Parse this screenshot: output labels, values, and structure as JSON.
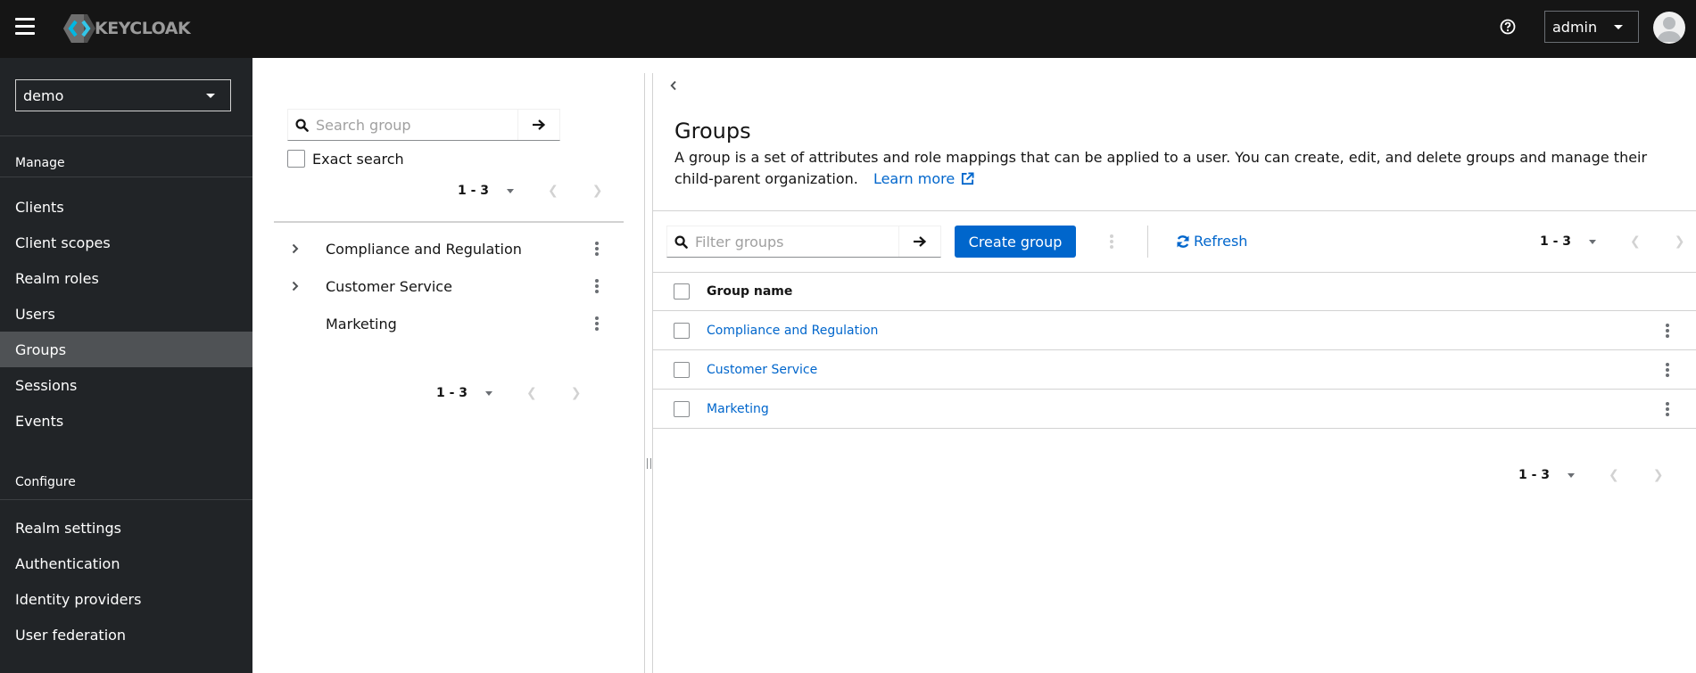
{
  "masthead": {
    "brand": "KEYCLOAK",
    "user": "admin",
    "icons": {
      "menu": "hamburger-icon",
      "help": "help-circle-icon",
      "avatar": "user-avatar-icon"
    }
  },
  "sidebar": {
    "realm": "demo",
    "sections": [
      {
        "title": "Manage",
        "items": [
          {
            "label": "Clients",
            "active": false
          },
          {
            "label": "Client scopes",
            "active": false
          },
          {
            "label": "Realm roles",
            "active": false
          },
          {
            "label": "Users",
            "active": false
          },
          {
            "label": "Groups",
            "active": true
          },
          {
            "label": "Sessions",
            "active": false
          },
          {
            "label": "Events",
            "active": false
          }
        ]
      },
      {
        "title": "Configure",
        "items": [
          {
            "label": "Realm settings",
            "active": false
          },
          {
            "label": "Authentication",
            "active": false
          },
          {
            "label": "Identity providers",
            "active": false
          },
          {
            "label": "User federation",
            "active": false
          }
        ]
      }
    ]
  },
  "tree": {
    "search_placeholder": "Search group",
    "search_value": "",
    "exact_search_label": "Exact search",
    "exact_search_checked": false,
    "pagination": "1 - 3",
    "items": [
      {
        "label": "Compliance and Regulation",
        "expandable": true
      },
      {
        "label": "Customer Service",
        "expandable": true
      },
      {
        "label": "Marketing",
        "expandable": false
      }
    ]
  },
  "main": {
    "title": "Groups",
    "description": "A group is a set of attributes and role mappings that can be applied to a user. You can create, edit, and delete groups and manage their child-parent organization.",
    "learn_more": "Learn more",
    "filter_placeholder": "Filter groups",
    "filter_value": "",
    "create_button": "Create group",
    "refresh_button": "Refresh",
    "pagination_top": "1 - 3",
    "pagination_bottom": "1 - 3",
    "table": {
      "columns": [
        "Group name"
      ],
      "rows": [
        {
          "name": "Compliance and Regulation"
        },
        {
          "name": "Customer Service"
        },
        {
          "name": "Marketing"
        }
      ]
    }
  },
  "colors": {
    "masthead_bg": "#151515",
    "sidebar_bg": "#212427",
    "sidebar_active_bg": "#4f5255",
    "primary": "#0066cc",
    "border": "#d2d2d2"
  }
}
